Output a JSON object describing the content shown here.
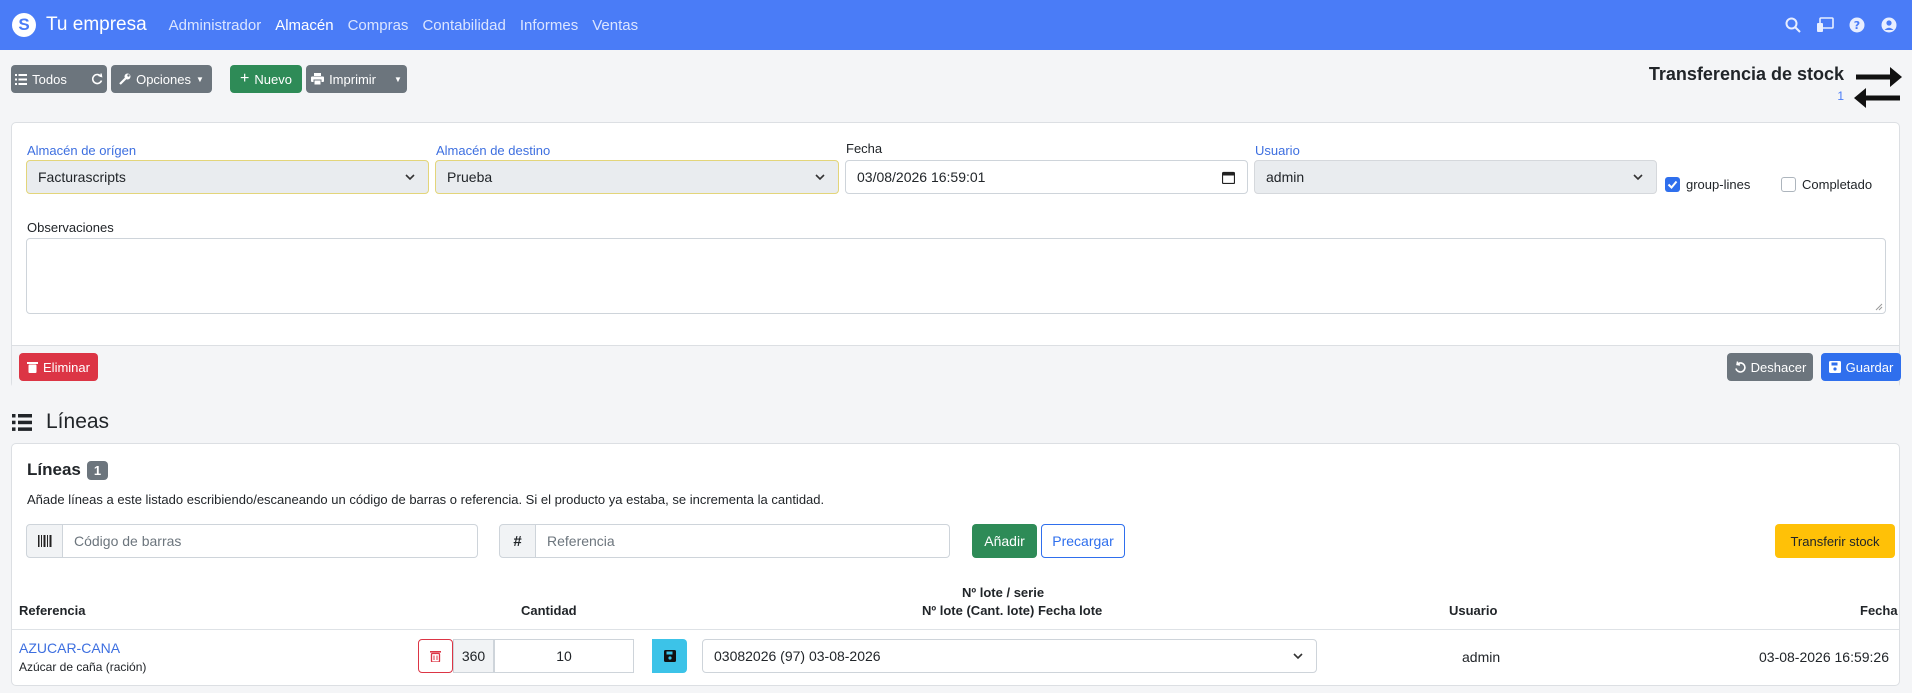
{
  "navbar": {
    "brand": "Tu empresa",
    "items": [
      "Administrador",
      "Almacén",
      "Compras",
      "Contabilidad",
      "Informes",
      "Ventas"
    ],
    "active": "Almacén",
    "icons": [
      "search-icon",
      "screen-icon",
      "help-icon",
      "user-icon"
    ]
  },
  "toolbar": {
    "all_label": "Todos",
    "options_label": "Opciones",
    "new_label": "Nuevo",
    "print_label": "Imprimir"
  },
  "page": {
    "title": "Transferencia de stock",
    "code": "1"
  },
  "form": {
    "origin_label": "Almacén de orígen",
    "origin_value": "Facturascripts",
    "dest_label": "Almacén de destino",
    "dest_value": "Prueba",
    "date_label": "Fecha",
    "date_value": "03/08/2026 16:59:01",
    "user_label": "Usuario",
    "user_value": "admin",
    "group_lines_label": "group-lines",
    "group_lines_checked": true,
    "completed_label": "Completado",
    "completed_checked": false,
    "notes_label": "Observaciones",
    "delete_label": "Eliminar",
    "undo_label": "Deshacer",
    "save_label": "Guardar"
  },
  "lines_section": {
    "heading": "Líneas",
    "card_title": "Líneas",
    "count": "1",
    "help": "Añade líneas a este listado escribiendo/escaneando un código de barras o referencia. Si el producto ya estaba, se incrementa la cantidad.",
    "barcode_placeholder": "Código de barras",
    "reference_placeholder": "Referencia",
    "add_label": "Añadir",
    "preload_label": "Precargar",
    "transfer_label": "Transferir stock",
    "columns": {
      "reference": "Referencia",
      "quantity": "Cantidad",
      "lot_line1": "Nº lote / serie",
      "lot_line2": "Nº lote (Cant. lote) Fecha lote",
      "user": "Usuario",
      "date": "Fecha"
    },
    "rows": [
      {
        "reference": "AZUCAR-CANA",
        "description": "Azúcar de caña (ración)",
        "stock": "360",
        "quantity": "10",
        "lot": "03082026 (97) 03-08-2026",
        "user": "admin",
        "date": "03-08-2026 16:59:26"
      }
    ]
  },
  "colors": {
    "navbar": "#4a7cf7",
    "green": "#2e8b57",
    "gray": "#6c757d",
    "red": "#dc3545",
    "blue": "#2f6fed",
    "yellow": "#ffc107",
    "cyan": "#3cc3e8"
  }
}
